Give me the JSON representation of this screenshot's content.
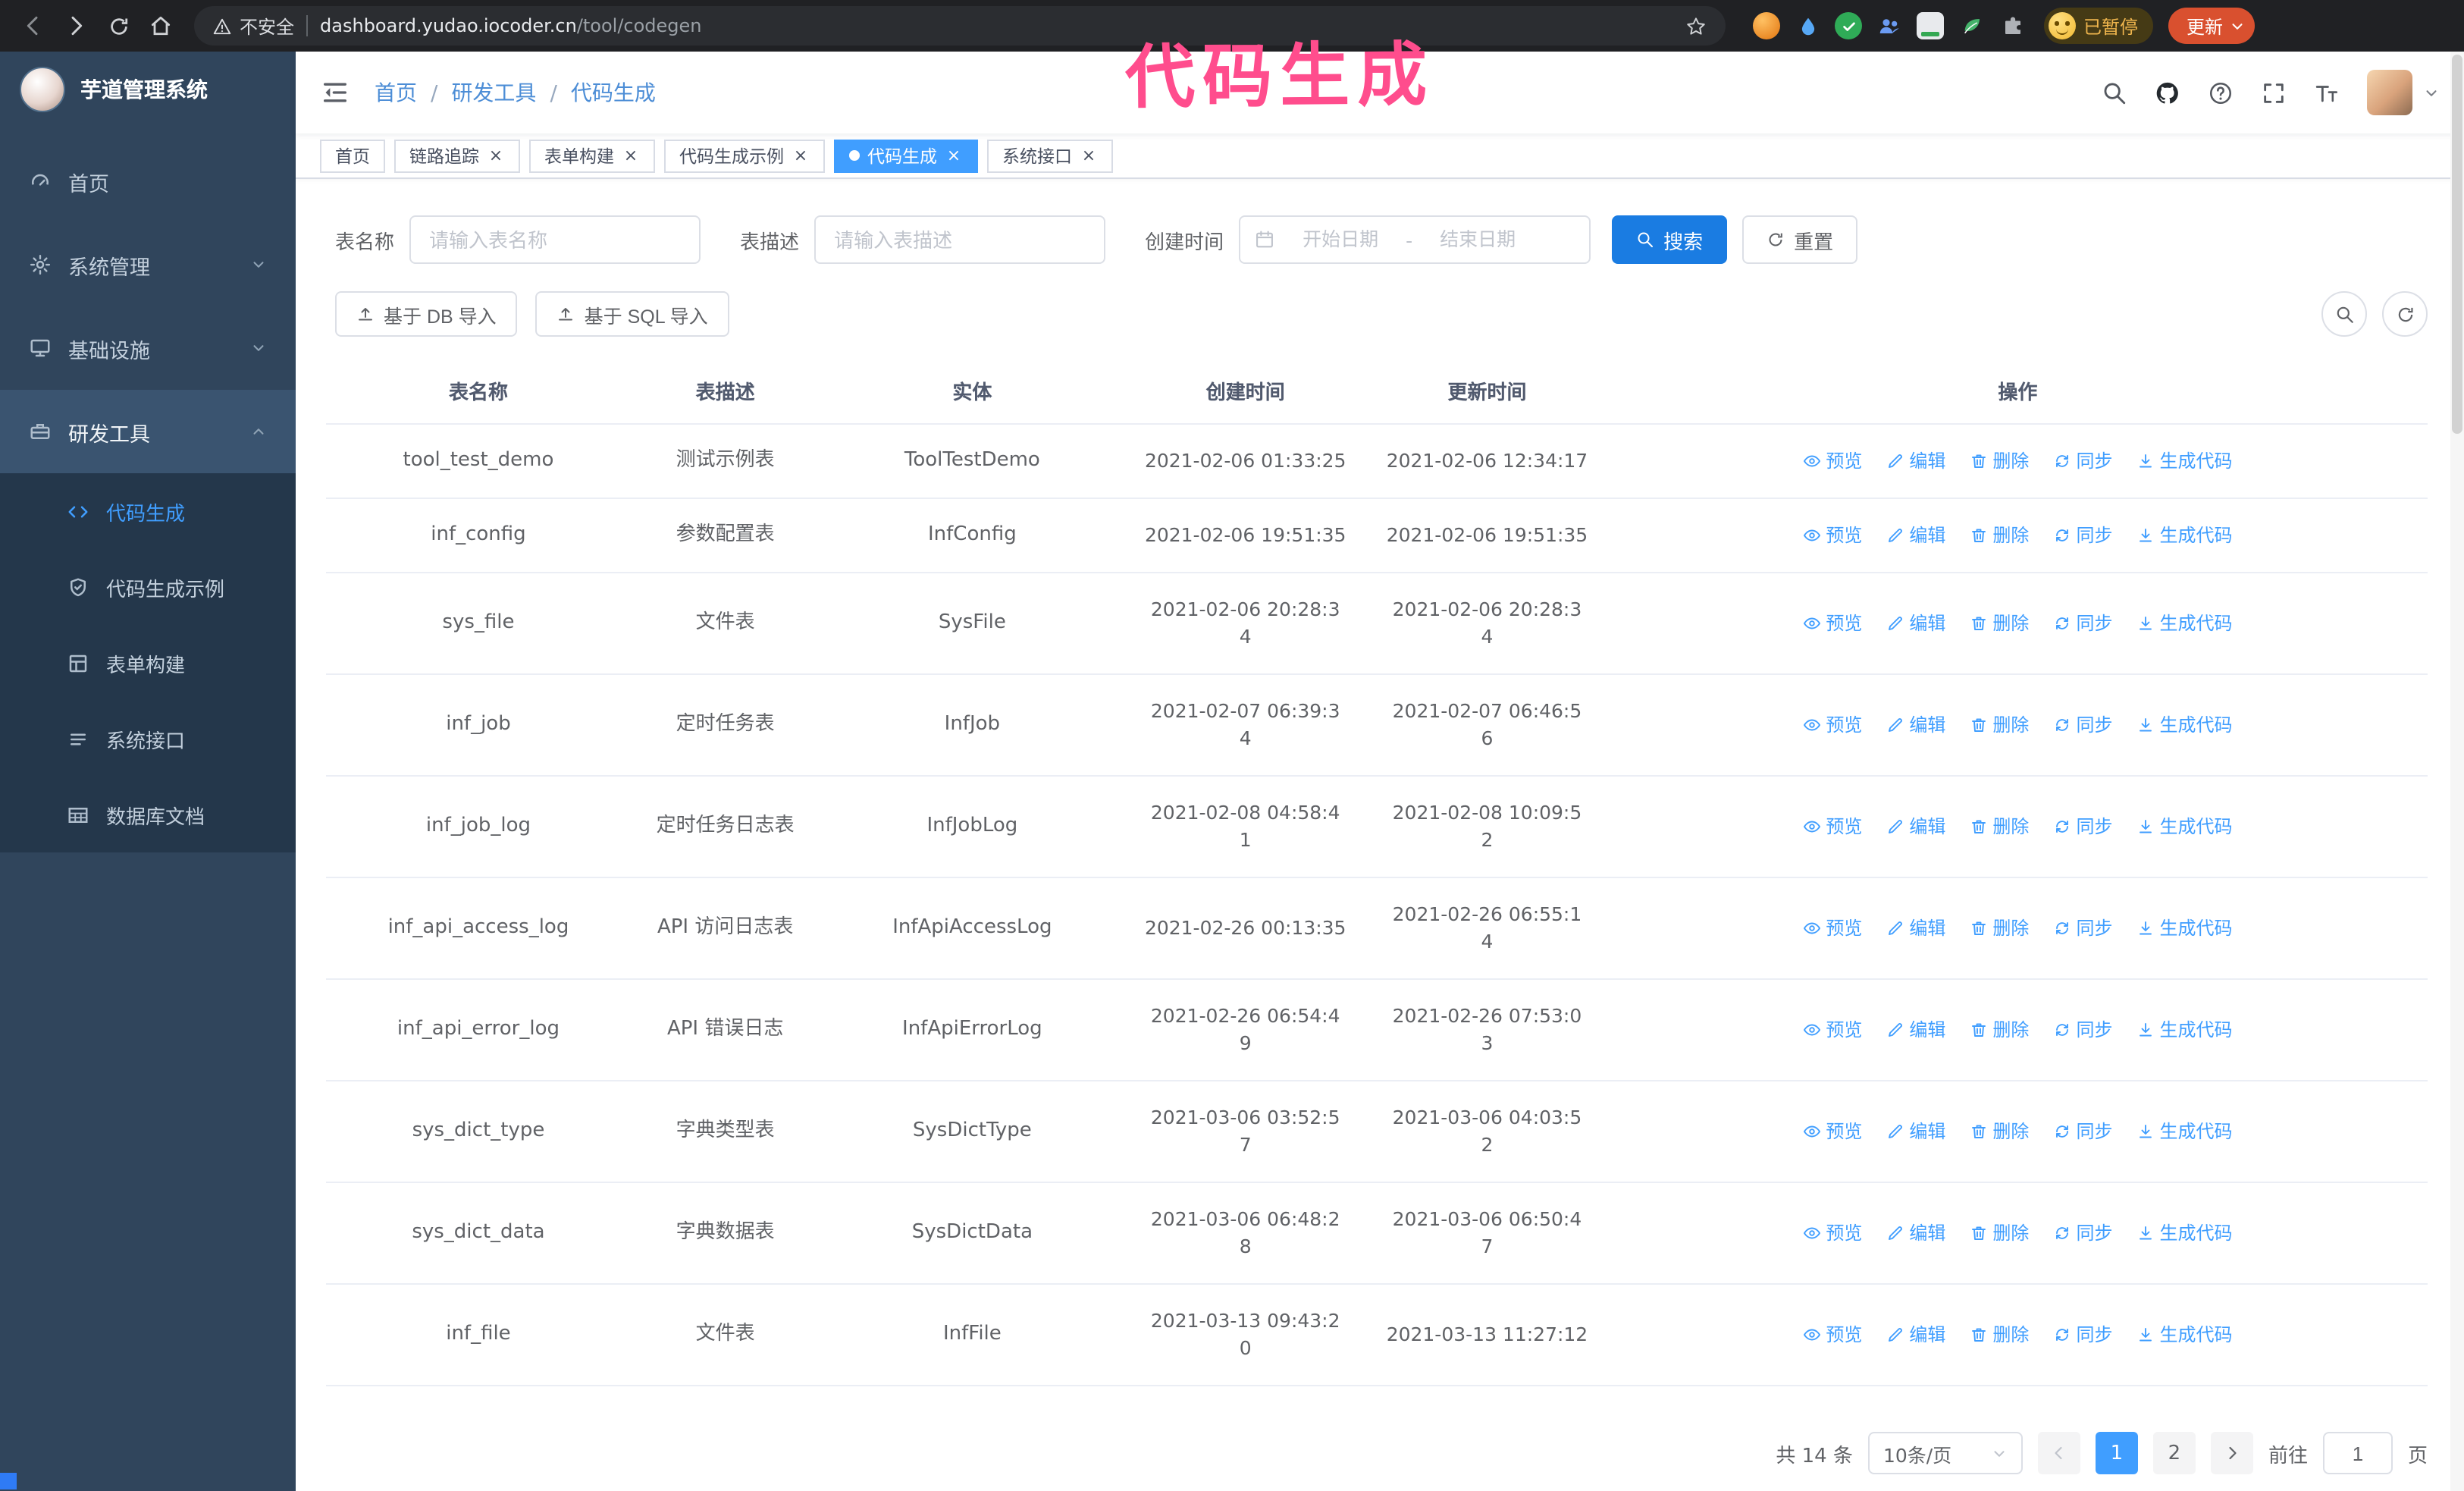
{
  "browser": {
    "security_label": "不安全",
    "url_host": "dashboard.yudao.iocoder.cn",
    "url_path": "/tool/codegen",
    "paused_badge": "已暂停",
    "update_button": "更新"
  },
  "annotation": {
    "text": "代码生成"
  },
  "colors": {
    "primary": "#409eff",
    "sidebar_bg": "#30455c",
    "submenu_bg": "#24374b",
    "search_button": "#1a7ce2",
    "annotation_pink": "#ff4d8d",
    "update_button_red": "#d9502f",
    "active_tab": "#409eff"
  },
  "sidebar": {
    "logo_title": "芋道管理系统",
    "items": [
      {
        "label": "首页"
      },
      {
        "label": "系统管理"
      },
      {
        "label": "基础设施"
      },
      {
        "label": "研发工具"
      }
    ],
    "submenu": [
      {
        "label": "代码生成"
      },
      {
        "label": "代码生成示例"
      },
      {
        "label": "表单构建"
      },
      {
        "label": "系统接口"
      },
      {
        "label": "数据库文档"
      }
    ]
  },
  "header": {
    "breadcrumb": [
      "首页",
      "研发工具",
      "代码生成"
    ]
  },
  "tabs": [
    {
      "label": "首页"
    },
    {
      "label": "链路追踪"
    },
    {
      "label": "表单构建"
    },
    {
      "label": "代码生成示例"
    },
    {
      "label": "代码生成"
    },
    {
      "label": "系统接口"
    }
  ],
  "filters": {
    "name_label": "表名称",
    "name_placeholder": "请输入表名称",
    "desc_label": "表描述",
    "desc_placeholder": "请输入表描述",
    "time_label": "创建时间",
    "date_start_placeholder": "开始日期",
    "date_sep": "-",
    "date_end_placeholder": "结束日期",
    "search_button": "搜索",
    "reset_button": "重置"
  },
  "toolbar": {
    "import_db": "基于 DB 导入",
    "import_sql": "基于 SQL 导入"
  },
  "table": {
    "columns": [
      "表名称",
      "表描述",
      "实体",
      "创建时间",
      "更新时间",
      "操作"
    ],
    "actions": [
      "预览",
      "编辑",
      "删除",
      "同步",
      "生成代码"
    ],
    "action_names": [
      "preview-link",
      "edit-link",
      "delete-link",
      "sync-link",
      "generate-code-link"
    ],
    "action_icons": [
      "eye-icon",
      "edit-icon",
      "delete-icon",
      "sync-icon",
      "generate-icon"
    ],
    "rows": [
      {
        "name": "tool_test_demo",
        "desc": "测试示例表",
        "entity": "ToolTestDemo",
        "created": "2021-02-06 01:33:25",
        "updated": "2021-02-06 12:34:17"
      },
      {
        "name": "inf_config",
        "desc": "参数配置表",
        "entity": "InfConfig",
        "created": "2021-02-06 19:51:35",
        "updated": "2021-02-06 19:51:35"
      },
      {
        "name": "sys_file",
        "desc": "文件表",
        "entity": "SysFile",
        "created": "2021-02-06 20:28:3\n4",
        "updated": "2021-02-06 20:28:3\n4"
      },
      {
        "name": "inf_job",
        "desc": "定时任务表",
        "entity": "InfJob",
        "created": "2021-02-07 06:39:3\n4",
        "updated": "2021-02-07 06:46:5\n6"
      },
      {
        "name": "inf_job_log",
        "desc": "定时任务日志表",
        "entity": "InfJobLog",
        "created": "2021-02-08 04:58:4\n1",
        "updated": "2021-02-08 10:09:5\n2"
      },
      {
        "name": "inf_api_access_log",
        "desc": "API 访问日志表",
        "entity": "InfApiAccessLog",
        "created": "2021-02-26 00:13:35",
        "updated": "2021-02-26 06:55:1\n4"
      },
      {
        "name": "inf_api_error_log",
        "desc": "API 错误日志",
        "entity": "InfApiErrorLog",
        "created": "2021-02-26 06:54:4\n9",
        "updated": "2021-02-26 07:53:0\n3"
      },
      {
        "name": "sys_dict_type",
        "desc": "字典类型表",
        "entity": "SysDictType",
        "created": "2021-03-06 03:52:5\n7",
        "updated": "2021-03-06 04:03:5\n2"
      },
      {
        "name": "sys_dict_data",
        "desc": "字典数据表",
        "entity": "SysDictData",
        "created": "2021-03-06 06:48:2\n8",
        "updated": "2021-03-06 06:50:4\n7"
      },
      {
        "name": "inf_file",
        "desc": "文件表",
        "entity": "InfFile",
        "created": "2021-03-13 09:43:2\n0",
        "updated": "2021-03-13 11:27:12"
      }
    ]
  },
  "pagination": {
    "total": "共 14 条",
    "page_size": "10条/页",
    "pages": [
      "1",
      "2"
    ],
    "goto_label": "前往",
    "goto_value": "1",
    "goto_suffix": "页"
  }
}
